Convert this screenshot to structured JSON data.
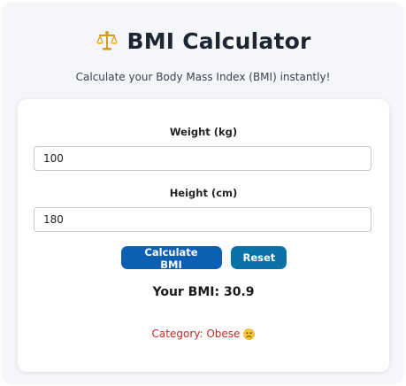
{
  "header": {
    "icon": "balance-scale-icon",
    "title": "BMI Calculator",
    "subtitle": "Calculate your Body Mass Index (BMI) instantly!"
  },
  "form": {
    "weight": {
      "label": "Weight (kg)",
      "value": "100"
    },
    "height": {
      "label": "Height (cm)",
      "value": "180"
    },
    "calculate_label": "Calculate BMI",
    "reset_label": "Reset"
  },
  "result": {
    "bmi_text": "Your BMI: 30.9",
    "category_text": "Category: Obese",
    "category_icon": "worried-face-icon"
  },
  "colors": {
    "background": "#f4f6fa",
    "primary_button": "#0d5fb3",
    "reset_button": "#0b72a8",
    "category_text": "#c62828"
  }
}
